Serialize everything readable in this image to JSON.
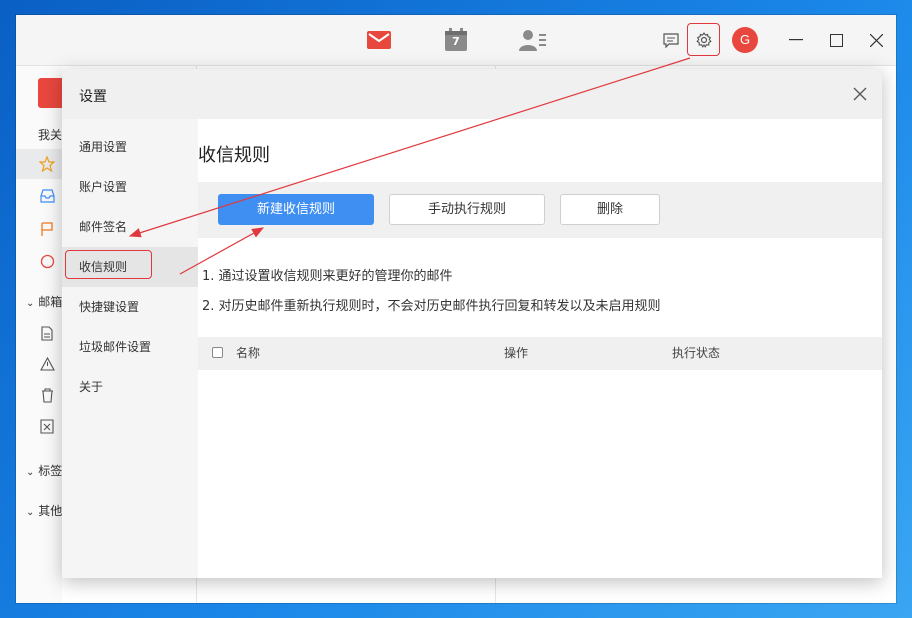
{
  "titlebar": {
    "icons": [
      "mail-icon",
      "calendar-icon",
      "contacts-icon",
      "chat-icon",
      "gear-icon"
    ],
    "calendar_day": "7",
    "avatar_initial": "G",
    "accent": "#e8473e"
  },
  "background_sidebar": {
    "my_label": "我关",
    "mailbox_label": "邮箱",
    "tags_label": "标签",
    "other_label": "其他"
  },
  "settings": {
    "title": "设置",
    "nav": [
      {
        "label": "通用设置"
      },
      {
        "label": "账户设置"
      },
      {
        "label": "邮件签名"
      },
      {
        "label": "收信规则",
        "active": true
      },
      {
        "label": "快捷键设置"
      },
      {
        "label": "垃圾邮件设置"
      },
      {
        "label": "关于"
      }
    ],
    "content": {
      "title": "收信规则",
      "buttons": {
        "new_rule": "新建收信规则",
        "run_rules": "手动执行规则",
        "delete": "删除"
      },
      "notes": [
        "1. 通过设置收信规则来更好的管理你的邮件",
        "2. 对历史邮件重新执行规则时，不会对历史邮件执行回复和转发以及未启用规则"
      ],
      "table": {
        "columns": [
          "名称",
          "操作",
          "执行状态"
        ]
      }
    }
  },
  "colors": {
    "primary_button": "#3f8ff2",
    "annotation": "#e0383e"
  }
}
